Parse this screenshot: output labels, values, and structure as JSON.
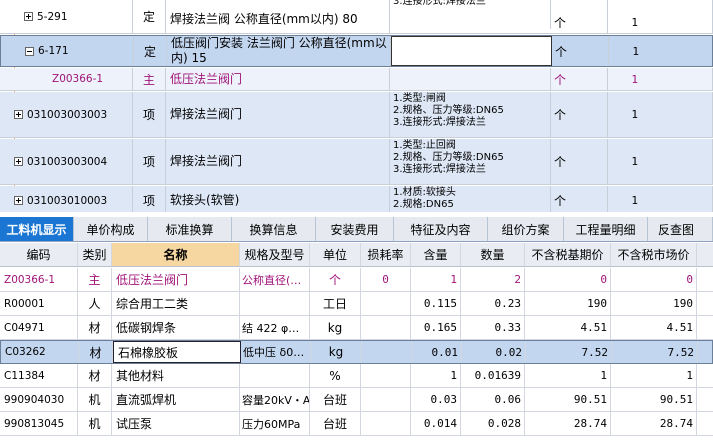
{
  "top_rows": [
    {
      "code": "5-291",
      "expander": "plus",
      "type": "定",
      "name": "焊接法兰阀 公称直径(mm以内) 80",
      "features": "3.连接形式:焊接法兰",
      "unit": "个",
      "qty": "1"
    },
    {
      "code": "6-171",
      "expander": "minus",
      "type": "定",
      "name": "低压阀门安装 法兰阀门 公称直径(mm以内) 15",
      "features": "",
      "unit": "个",
      "qty": "1"
    },
    {
      "code": "Z00366-1",
      "expander": "",
      "type": "主",
      "name": "低压法兰阀门",
      "features": "",
      "unit": "个",
      "qty": "1"
    },
    {
      "code": "031003003003",
      "expander": "plus",
      "type": "项",
      "name": "焊接法兰阀门",
      "features": "1.类型:闸阀\n2.规格、压力等级:DN65\n3.连接形式:焊接法兰",
      "unit": "个",
      "qty": "1"
    },
    {
      "code": "031003003004",
      "expander": "plus",
      "type": "项",
      "name": "焊接法兰阀门",
      "features": "1.类型:止回阀\n2.规格、压力等级:DN65\n3.连接形式:焊接法兰",
      "unit": "个",
      "qty": "1"
    },
    {
      "code": "031003010003",
      "expander": "plus",
      "type": "项",
      "name": "软接头(软管)",
      "features": "1.材质:软接头\n2.规格:DN65",
      "unit": "个",
      "qty": "1"
    }
  ],
  "tabs": [
    "工料机显示",
    "单价构成",
    "标准换算",
    "换算信息",
    "安装费用",
    "特征及内容",
    "组价方案",
    "工程量明细",
    "反查图"
  ],
  "columns": [
    "编码",
    "类别",
    "名称",
    "规格及型号",
    "单位",
    "损耗率",
    "含量",
    "数量",
    "不含税基期价",
    "不含税市场价"
  ],
  "rows": [
    {
      "code": "Z00366-1",
      "cat": "主",
      "name": "低压法兰阀门",
      "spec": "公称直径(…",
      "unit": "个",
      "loss": "0",
      "amt": "1",
      "qty": "2",
      "base": "0",
      "mkt": "0"
    },
    {
      "code": "R00001",
      "cat": "人",
      "name": "综合用工二类",
      "spec": "",
      "unit": "工日",
      "loss": "",
      "amt": "0.115",
      "qty": "0.23",
      "base": "190",
      "mkt": "190"
    },
    {
      "code": "C04971",
      "cat": "材",
      "name": "低碳钢焊条",
      "spec": "结 422 φ…",
      "unit": "kg",
      "loss": "",
      "amt": "0.165",
      "qty": "0.33",
      "base": "4.51",
      "mkt": "4.51"
    },
    {
      "code": "C03262",
      "cat": "材",
      "name": "石棉橡胶板",
      "spec": "低中压 δ0…",
      "unit": "kg",
      "loss": "",
      "amt": "0.01",
      "qty": "0.02",
      "base": "7.52",
      "mkt": "7.52"
    },
    {
      "code": "C11384",
      "cat": "材",
      "name": "其他材料",
      "spec": "",
      "unit": "%",
      "loss": "",
      "amt": "1",
      "qty": "0.01639",
      "base": "1",
      "mkt": "1"
    },
    {
      "code": "990904030",
      "cat": "机",
      "name": "直流弧焊机",
      "spec": "容量20kV・A",
      "unit": "台班",
      "loss": "",
      "amt": "0.03",
      "qty": "0.06",
      "base": "90.51",
      "mkt": "90.51"
    },
    {
      "code": "990813045",
      "cat": "机",
      "name": "试压泵",
      "spec": "压力60MPa",
      "unit": "台班",
      "loss": "",
      "amt": "0.014",
      "qty": "0.028",
      "base": "28.74",
      "mkt": "28.74"
    }
  ],
  "colors": {
    "active_tab": "#1b76d3",
    "main_material_text": "#a0147a",
    "selected_row": "#c3d6ef",
    "name_header": "#f6d7a2"
  }
}
